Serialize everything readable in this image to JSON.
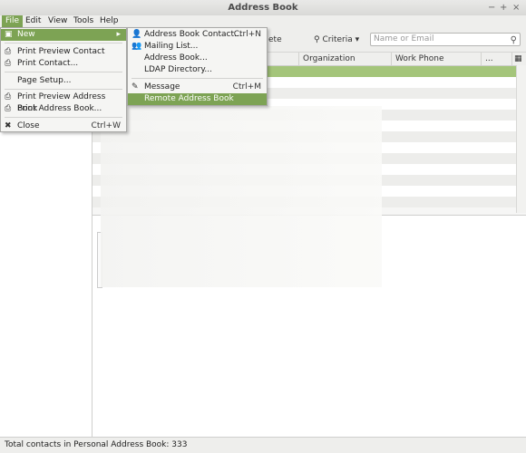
{
  "window": {
    "title": "Address Book"
  },
  "menubar": [
    "File",
    "Edit",
    "View",
    "Tools",
    "Help"
  ],
  "toolbar": {
    "criteria_label": "Criteria",
    "search_placeholder": "Name or Email",
    "partial_delete_label": "ete"
  },
  "table": {
    "columns": [
      "Organization",
      "Work Phone",
      "..."
    ]
  },
  "file_menu": {
    "new": "New",
    "print_preview_contact": "Print Preview Contact",
    "print_contact": "Print Contact...",
    "page_setup": "Page Setup...",
    "print_preview_address_book": "Print Preview Address Book",
    "print_address_book": "Print Address Book...",
    "close": "Close",
    "close_shortcut": "Ctrl+W"
  },
  "new_menu": {
    "address_book_contact": "Address Book Contact...",
    "address_book_contact_shortcut": "Ctrl+N",
    "mailing_list": "Mailing List...",
    "address_book": "Address Book...",
    "ldap_directory": "LDAP Directory...",
    "message": "Message",
    "message_shortcut": "Ctrl+M",
    "remote_address_book": "Remote Address Book"
  },
  "status": {
    "text": "Total contacts in Personal Address Book: 333"
  },
  "colors": {
    "accent": "#7da354",
    "selection_row": "#a4c57a"
  }
}
